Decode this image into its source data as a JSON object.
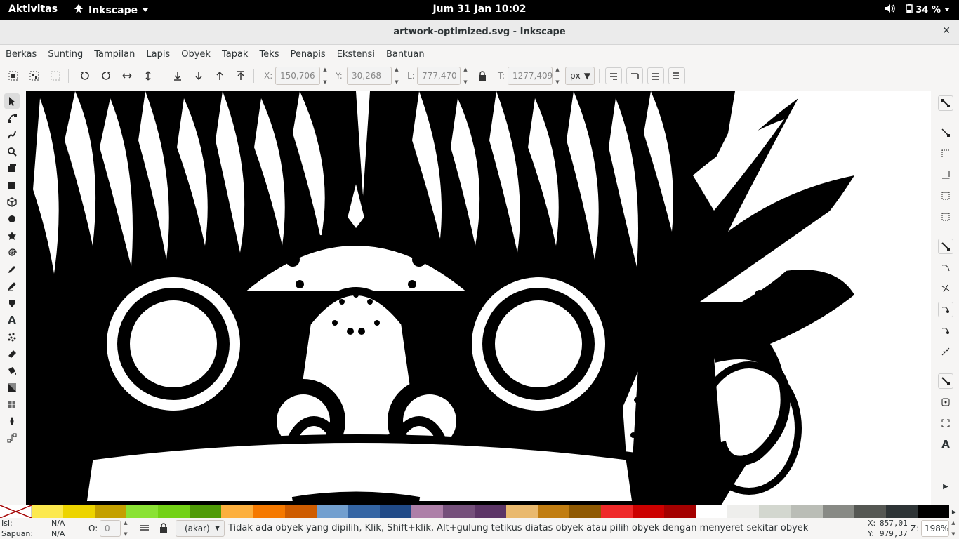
{
  "topbar": {
    "activities": "Aktivitas",
    "app_name": "Inkscape",
    "clock": "Jum 31 Jan  10:02",
    "battery": "34 %"
  },
  "window": {
    "title": "artwork-optimized.svg - Inkscape",
    "close_glyph": "✕"
  },
  "menu": [
    "Berkas",
    "Sunting",
    "Tampilan",
    "Lapis",
    "Obyek",
    "Tapak",
    "Teks",
    "Penapis",
    "Ekstensi",
    "Bantuan"
  ],
  "toolbar": {
    "x_label": "X:",
    "x_value": "150,706",
    "y_label": "Y:",
    "y_value": "30,268",
    "w_label": "L:",
    "w_value": "777,470",
    "h_label": "T:",
    "h_value": "1277,409",
    "unit": "px"
  },
  "palette": {
    "colors": [
      "#fce94f",
      "#edd400",
      "#c4a000",
      "#8ae234",
      "#73d216",
      "#4e9a06",
      "#fcaf3e",
      "#f57900",
      "#ce5c00",
      "#729fcf",
      "#3465a4",
      "#204a87",
      "#ad7fa8",
      "#75507b",
      "#5c3566",
      "#e9b96e",
      "#c17d11",
      "#8f5902",
      "#ef2929",
      "#cc0000",
      "#a40000",
      "#ffffff",
      "#eeeeec",
      "#d3d7cf",
      "#babdb6",
      "#888a85",
      "#555753",
      "#2e3436",
      "#000000"
    ]
  },
  "status": {
    "fill_label": "Isi:",
    "fill_value": "N/A",
    "stroke_label": "Sapuan:",
    "stroke_value": "N/A",
    "opacity_label": "O:",
    "opacity_value": "0",
    "layer": "(akar)",
    "message": "Tidak ada obyek yang dipilih, Klik, Shift+klik, Alt+gulung tetikus diatas obyek atau pilih obyek dengan menyeret sekitar obyek",
    "x_label": "X:",
    "x_value": "857,01",
    "y_label": "Y:",
    "y_value": "979,37",
    "zoom_label": "Z:",
    "zoom_value": "198%"
  },
  "icons": {
    "tools": [
      "selector-icon",
      "node-icon",
      "tweak-icon",
      "zoom-icon",
      "measure-icon",
      "rect-icon",
      "box3d-icon",
      "ellipse-icon",
      "star-icon",
      "spiral-icon",
      "pencil-icon",
      "pen-icon",
      "calligraphy-icon",
      "text-icon",
      "spray-icon",
      "eraser-icon",
      "bucket-icon",
      "gradient-icon",
      "mesh-icon",
      "dropper-icon",
      "connector-icon"
    ],
    "snaps": [
      "snap-toggle-icon",
      "snap-bbox-icon",
      "snap-bbox-edge-icon",
      "snap-bbox-corner-icon",
      "snap-bbox-midpoint-icon",
      "snap-bbox-center-icon",
      "snap-nodes-icon",
      "snap-path-icon",
      "snap-intersection-icon",
      "snap-cusp-icon",
      "snap-smooth-icon",
      "snap-midpoint-icon",
      "snap-others-icon",
      "snap-center-icon",
      "snap-rotation-center-icon",
      "snap-text-baseline-icon",
      "more-icon"
    ]
  }
}
